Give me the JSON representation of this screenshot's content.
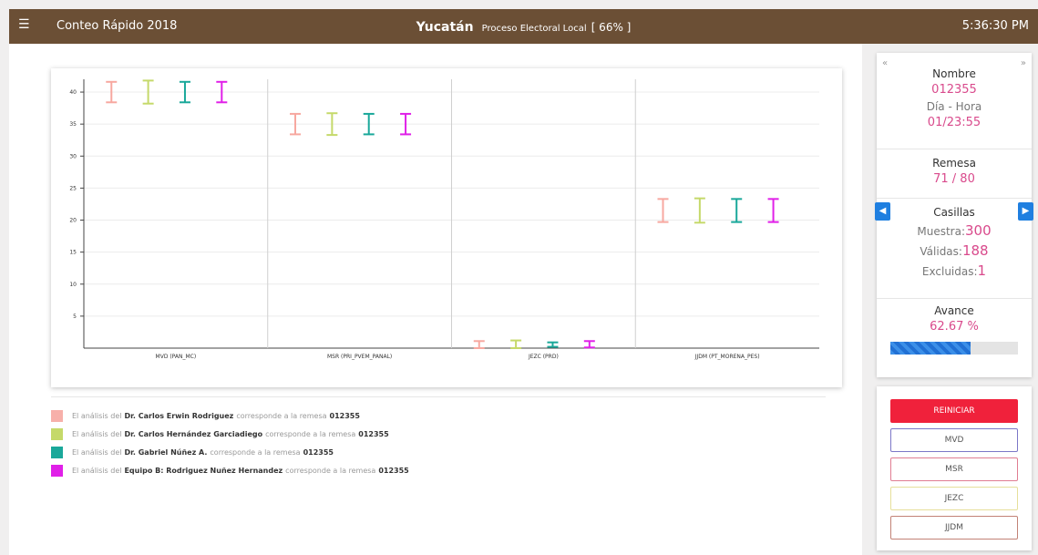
{
  "header": {
    "menu_icon": "☰",
    "title": "Conteo Rápido 2018",
    "state": "Yucatán",
    "process": "Proceso Electoral Local",
    "percent": "[ 66% ]",
    "clock": "5:36:30 PM"
  },
  "chart_data": {
    "type": "errorbar",
    "categories": [
      "MVD (PAN_MC)",
      "MSR (PRI_PVEM_PANAL)",
      "JEZC (PRD)",
      "JJDM (PT_MORENA_PES)"
    ],
    "y_ticks": [
      5,
      10,
      15,
      20,
      25,
      30,
      35,
      40
    ],
    "ylim": [
      0,
      42
    ],
    "grid": true,
    "series": [
      {
        "color": "#f7a8a0",
        "intervals": [
          [
            38.4,
            41.6
          ],
          [
            33.4,
            36.6
          ],
          [
            0,
            1.1
          ],
          [
            19.7,
            23.3
          ]
        ]
      },
      {
        "color": "#c5d96a",
        "intervals": [
          [
            38.2,
            41.8
          ],
          [
            33.3,
            36.7
          ],
          [
            0,
            1.2
          ],
          [
            19.6,
            23.4
          ]
        ]
      },
      {
        "color": "#1aa89a",
        "intervals": [
          [
            38.4,
            41.6
          ],
          [
            33.4,
            36.6
          ],
          [
            0.2,
            0.9
          ],
          [
            19.7,
            23.3
          ]
        ]
      },
      {
        "color": "#e020e8",
        "intervals": [
          [
            38.4,
            41.6
          ],
          [
            33.4,
            36.6
          ],
          [
            0.1,
            1.1
          ],
          [
            19.7,
            23.3
          ]
        ]
      }
    ]
  },
  "legend": [
    {
      "color": "#f7b0aa",
      "prefix": "El análisis del",
      "name": "Dr. Carlos Erwin Rodriguez",
      "middle": "corresponde a la remesa",
      "remesa": "012355"
    },
    {
      "color": "#c5d96a",
      "prefix": "El análisis del",
      "name": "Dr. Carlos Hernández Garciadiego",
      "middle": "corresponde a la remesa",
      "remesa": "012355"
    },
    {
      "color": "#1aa89a",
      "prefix": "El análisis del",
      "name": "Dr. Gabriel Núñez A.",
      "middle": "corresponde a la remesa",
      "remesa": "012355"
    },
    {
      "color": "#e020e8",
      "prefix": "El análisis del",
      "name": "Equipo B: Rodriguez Nuñez Hernandez",
      "middle": "corresponde a la remesa",
      "remesa": "012355"
    }
  ],
  "panel": {
    "nav_prev": "«",
    "nav_next": "»",
    "nombre_label": "Nombre",
    "nombre_value": "012355",
    "dia_label": "Día - Hora",
    "dia_value": "01/23:55",
    "remesa_label": "Remesa",
    "remesa_value": "71 / 80",
    "casillas_label": "Casillas",
    "muestra_label": "Muestra:",
    "muestra_value": "300",
    "validas_label": "Válidas:",
    "validas_value": "188",
    "excluidas_label": "Excluidas:",
    "excluidas_value": "1",
    "avance_label": "Avance",
    "avance_value": "62.67 %",
    "avance_fraction": 0.6267,
    "arrow_left": "◀",
    "arrow_right": "▶"
  },
  "buttons": {
    "reset": "REINICIAR",
    "mvd": "MVD",
    "msr": "MSR",
    "jezc": "JEZC",
    "jjdm": "JJDM",
    "colors": {
      "mvd": "#7c77c7",
      "msr": "#e07d92",
      "jezc": "#e6df9a",
      "jjdm": "#c28276"
    }
  }
}
